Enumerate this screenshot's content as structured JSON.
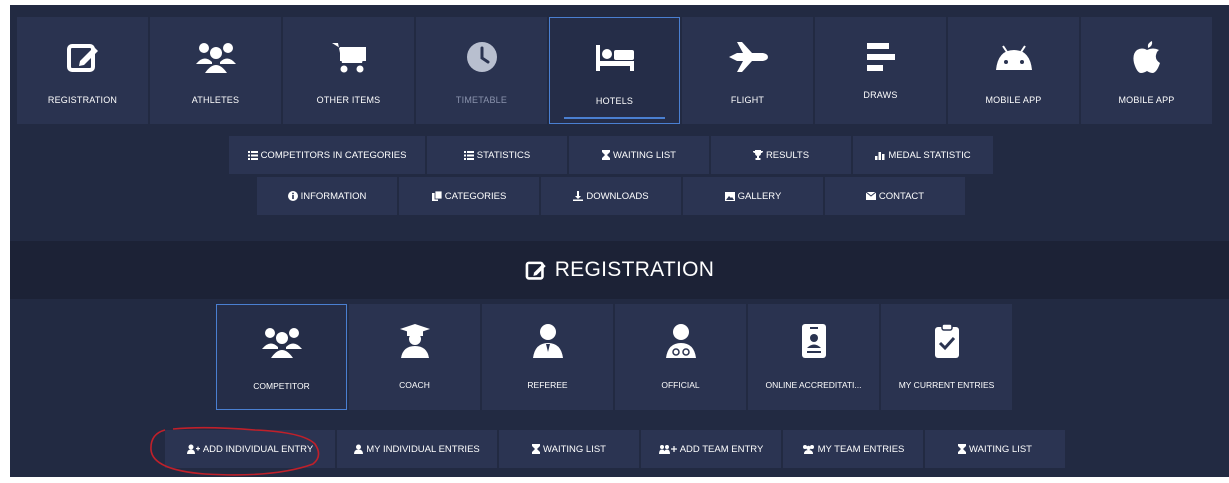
{
  "nav": {
    "tiles": [
      {
        "label": "REGISTRATION",
        "icon": "edit-icon"
      },
      {
        "label": "ATHLETES",
        "icon": "users-icon"
      },
      {
        "label": "OTHER ITEMS",
        "icon": "cart-icon"
      },
      {
        "label": "TIMETABLE",
        "icon": "clock-icon"
      },
      {
        "label": "HOTELS",
        "icon": "bed-icon"
      },
      {
        "label": "FLIGHT",
        "icon": "plane-icon"
      },
      {
        "label": "DRAWS",
        "icon": "draws-icon"
      },
      {
        "label": "MOBILE APP",
        "icon": "android-icon"
      },
      {
        "label": "MOBILE APP",
        "icon": "apple-icon"
      }
    ]
  },
  "links_row1": [
    {
      "label": "COMPETITORS IN CATEGORIES",
      "icon": "list-icon"
    },
    {
      "label": "STATISTICS",
      "icon": "list-icon"
    },
    {
      "label": "WAITING LIST",
      "icon": "hourglass-icon"
    },
    {
      "label": "RESULTS",
      "icon": "trophy-icon"
    },
    {
      "label": "MEDAL STATISTIC",
      "icon": "bar-chart-icon"
    }
  ],
  "links_row2": [
    {
      "label": "INFORMATION",
      "icon": "info-icon"
    },
    {
      "label": "CATEGORIES",
      "icon": "copy-icon"
    },
    {
      "label": "DOWNLOADS",
      "icon": "download-icon"
    },
    {
      "label": "GALLERY",
      "icon": "image-icon"
    },
    {
      "label": "CONTACT",
      "icon": "envelope-icon"
    }
  ],
  "section": {
    "title": "REGISTRATION",
    "icon": "edit-icon"
  },
  "registration_types": [
    {
      "label": "COMPETITOR",
      "icon": "users-icon"
    },
    {
      "label": "COACH",
      "icon": "graduate-icon"
    },
    {
      "label": "REFEREE",
      "icon": "referee-icon"
    },
    {
      "label": "OFFICIAL",
      "icon": "doctor-icon"
    },
    {
      "label": "ONLINE ACCREDITATI...",
      "icon": "id-badge-icon"
    },
    {
      "label": "MY CURRENT ENTRIES",
      "icon": "clipboard-check-icon"
    }
  ],
  "actions": [
    {
      "label": "ADD INDIVIDUAL ENTRY",
      "icon": "user-plus-icon"
    },
    {
      "label": "MY INDIVIDUAL ENTRIES",
      "icon": "user-icon"
    },
    {
      "label": "WAITING LIST",
      "icon": "hourglass-icon"
    },
    {
      "label": "ADD TEAM ENTRY",
      "icon": "users-plus-icon"
    },
    {
      "label": "MY TEAM ENTRIES",
      "icon": "users-icon"
    },
    {
      "label": "WAITING LIST",
      "icon": "hourglass-icon"
    }
  ],
  "colors": {
    "background": "#222a42",
    "tile": "#2a3350",
    "accent": "#4a7fd1",
    "annotation": "#c0202a"
  }
}
